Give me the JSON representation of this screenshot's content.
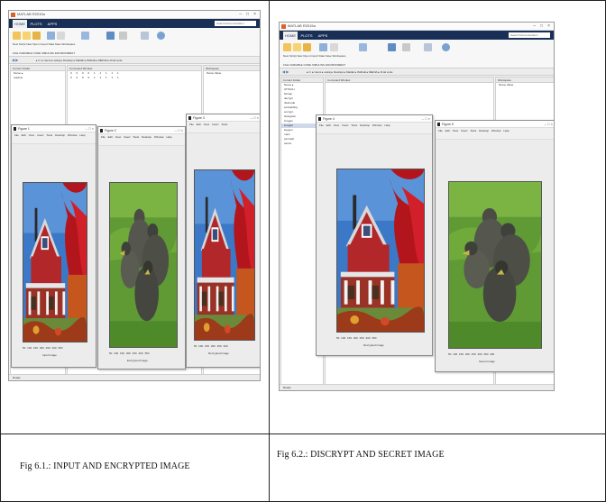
{
  "captions": {
    "left": "Fig 6.1.: INPUT AND ENCRYPTED   IMAGE",
    "right": "Fig 6.2.: DISCRYPT AND SECRET  IMAGE"
  },
  "figure_titles": {
    "left_1": "Figure 1",
    "left_2": "Figure 2",
    "left_3": "Figure 3",
    "right_1": "Figure 4",
    "right_2": "Figure 5"
  },
  "image_labels": {
    "left_1": "Input Image",
    "left_2": "Encrypted Image",
    "left_3": "Decrypted Image",
    "right_1": "Decrypted Image",
    "right_2": "Secret Image"
  },
  "colors": {
    "matlab_tabstrip": "#1a2f56",
    "matlab_logo": "#d9622b",
    "house_red": "#b2282a",
    "sky_blue": "#3b78c8",
    "grass_green": "#5f9a35"
  },
  "icons": [
    "matlab-logo-icon",
    "figure-icon",
    "minimize-icon",
    "maximize-icon",
    "close-icon"
  ]
}
